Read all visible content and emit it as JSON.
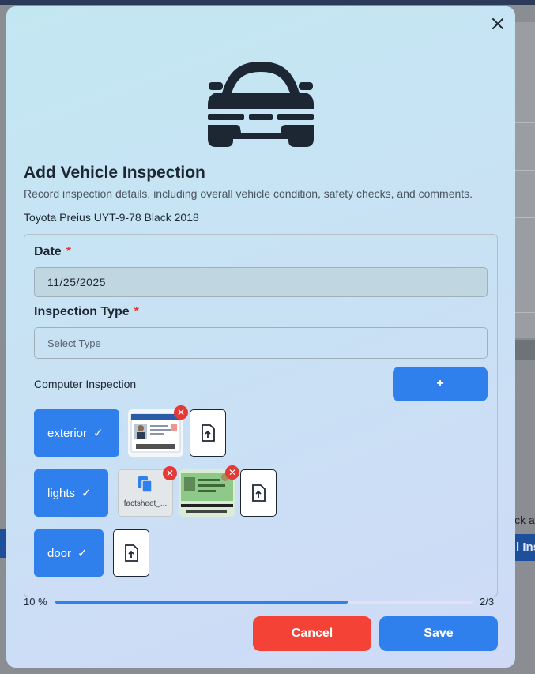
{
  "modal": {
    "title": "Add Vehicle Inspection",
    "subtitle": "Record inspection details, including overall vehicle condition, safety checks, and comments.",
    "vehicle": "Toyota Preius UYT-9-78 Black 2018"
  },
  "form": {
    "date_label": "Date",
    "date_required": "*",
    "date_value": "11/25/2025",
    "type_label": "Inspection Type",
    "type_required": "*",
    "type_placeholder": "Select Type",
    "computer_inspection_label": "Computer Inspection",
    "add_button": "+",
    "categories": [
      {
        "label": "exterior",
        "check": "✓"
      },
      {
        "label": "lights",
        "check": "✓"
      },
      {
        "label": "door",
        "check": "✓"
      }
    ],
    "file_name": "factsheet_...",
    "remove_glyph": "✕"
  },
  "progress": {
    "percent_label": "10 %",
    "fill_fraction": 0.701,
    "step_label": "2/3"
  },
  "actions": {
    "cancel": "Cancel",
    "save": "Save"
  },
  "background": {
    "partial_text": "ick a",
    "partial_button": "l Ins"
  },
  "colors": {
    "primary": "#2f80ed",
    "danger": "#f44336",
    "text": "#1d2733"
  },
  "icons": {
    "close": "close-icon",
    "car": "car-icon",
    "check": "check-icon",
    "upload": "upload-file-icon",
    "remove": "remove-icon",
    "document": "document-icon"
  }
}
